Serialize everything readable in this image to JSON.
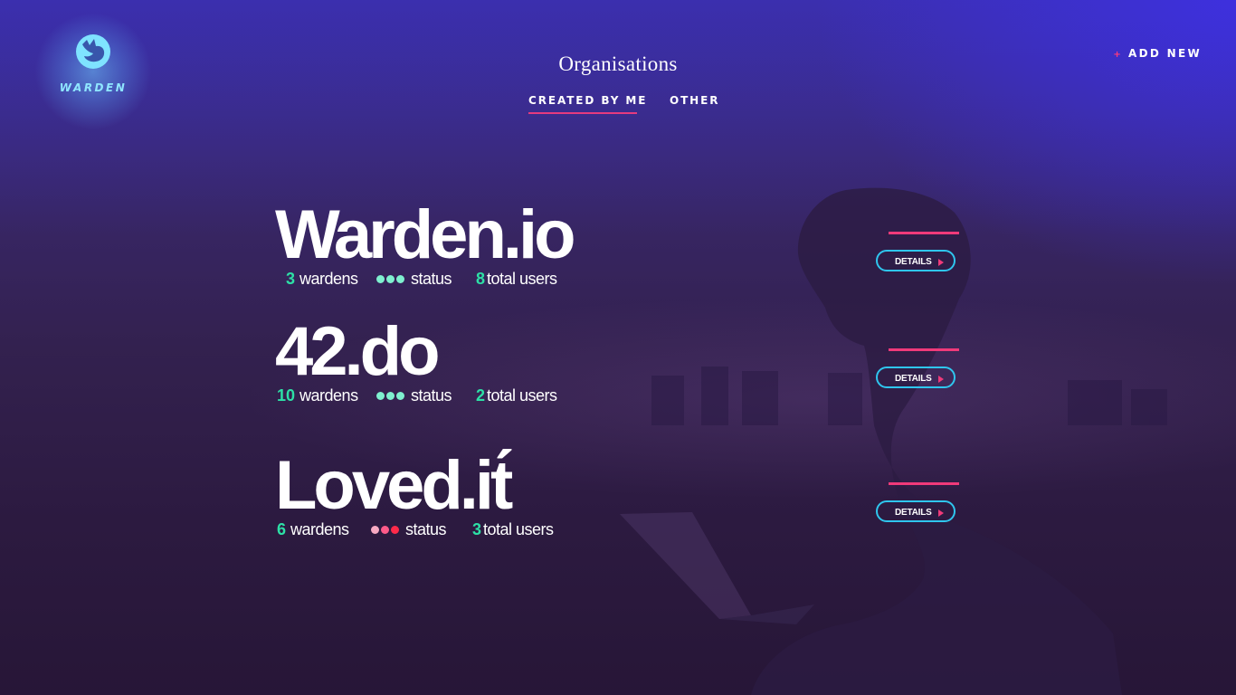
{
  "app": {
    "logo_text": "WARDEN",
    "logo_icon": "whale-mark-icon"
  },
  "header": {
    "title": "Organisations",
    "tabs": [
      {
        "label": "CREATED BY ME",
        "active": true
      },
      {
        "label": "OTHER",
        "active": false
      }
    ],
    "add_new": {
      "icon": "plus-icon",
      "label": "ADD NEW"
    }
  },
  "colors": {
    "accent_pink": "#f03a7a",
    "accent_cyan": "#2fc6ee",
    "number_green": "#2de0a6",
    "status_ok": "#7ff0cf",
    "status_bad_light": "#f7a9c2",
    "status_bad_mid": "#ff5b8a",
    "status_bad_dark": "#ff2a4a"
  },
  "organisations": [
    {
      "name": "Warden.io",
      "wardens_count": "3",
      "wardens_label": "wardens",
      "status_label": "status",
      "status_dots": [
        "#7ff0cf",
        "#7ff0cf",
        "#7ff0cf"
      ],
      "users_count": "8",
      "users_label": "total users",
      "details_label": "DETAILS"
    },
    {
      "name": "42.do",
      "wardens_count": "10",
      "wardens_label": "wardens",
      "status_label": "status",
      "status_dots": [
        "#7ff0cf",
        "#7ff0cf",
        "#7ff0cf"
      ],
      "users_count": "2",
      "users_label": "total users",
      "details_label": "DETAILS"
    },
    {
      "name": "Loved.it́",
      "wardens_count": "6",
      "wardens_label": "wardens",
      "status_label": "status",
      "status_dots": [
        "#f7a9c2",
        "#ff5b8a",
        "#ff2a4a"
      ],
      "users_count": "3",
      "users_label": "total users",
      "details_label": "DETAILS"
    }
  ]
}
